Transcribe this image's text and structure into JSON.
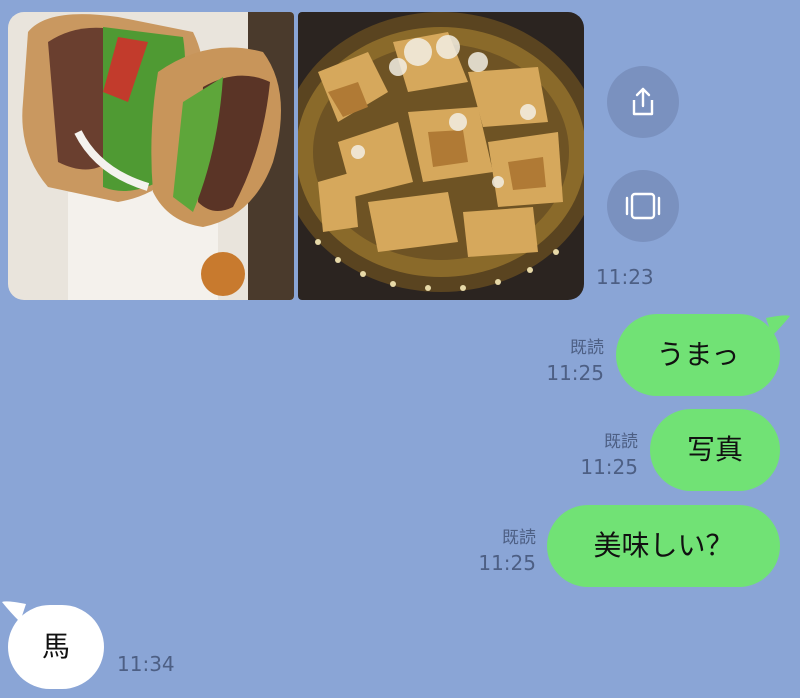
{
  "photos": [
    {
      "icon": "sandwich-photo"
    },
    {
      "icon": "fries-photo"
    }
  ],
  "photo_actions": {
    "share_icon": "share-icon",
    "fullscreen_icon": "gallery-icon"
  },
  "photo_time": "11:23",
  "messages": [
    {
      "text": "うまっ",
      "read_label": "既読",
      "time": "11:25"
    },
    {
      "text": "写真",
      "read_label": "既読",
      "time": "11:25"
    },
    {
      "text": "美味しい？",
      "read_label": "既読",
      "time": "11:25"
    }
  ],
  "incoming": {
    "text": "馬",
    "time": "11:34"
  },
  "colors": {
    "background": "#8aa5d6",
    "outgoing_bubble": "#71e275",
    "incoming_bubble": "#ffffff",
    "meta_text": "#4d5f84"
  }
}
